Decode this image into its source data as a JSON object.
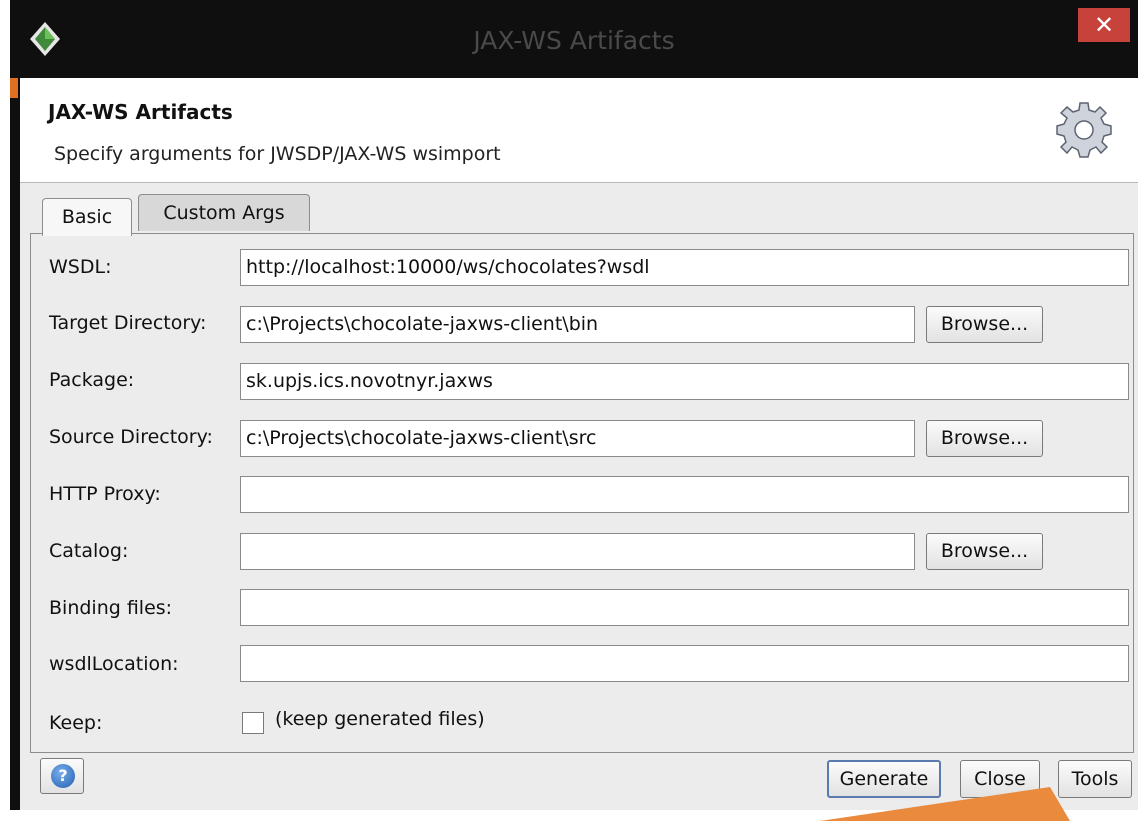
{
  "window": {
    "title": "JAX-WS Artifacts",
    "close_glyph": "✕",
    "app_icon": "diamond-app-icon"
  },
  "header": {
    "title": "JAX-WS Artifacts",
    "description": "Specify arguments for JWSDP/JAX-WS wsimport",
    "icon": "gear-icon"
  },
  "tabs": [
    {
      "label": "Basic",
      "selected": true
    },
    {
      "label": "Custom Args",
      "selected": false
    }
  ],
  "form": {
    "wsdl": {
      "label": "WSDL:",
      "value": "http://localhost:10000/ws/chocolates?wsdl"
    },
    "target_directory": {
      "label": "Target Directory:",
      "value": "c:\\Projects\\chocolate-jaxws-client\\bin",
      "browse_label": "Browse..."
    },
    "package": {
      "label": "Package:",
      "value": "sk.upjs.ics.novotnyr.jaxws"
    },
    "source_directory": {
      "label": "Source Directory:",
      "value": "c:\\Projects\\chocolate-jaxws-client\\src",
      "browse_label": "Browse..."
    },
    "http_proxy": {
      "label": "HTTP Proxy:",
      "value": ""
    },
    "catalog": {
      "label": "Catalog:",
      "value": "",
      "browse_label": "Browse..."
    },
    "binding_files": {
      "label": "Binding files:",
      "value": ""
    },
    "wsdl_location": {
      "label": "wsdlLocation:",
      "value": ""
    },
    "keep": {
      "label": "Keep:",
      "checkbox_label": "(keep generated files)",
      "checked": false
    }
  },
  "footer": {
    "help_glyph": "?",
    "generate_label": "Generate",
    "close_label": "Close",
    "tools_label": "Tools"
  },
  "colors": {
    "titlebar": "#0f0f0f",
    "close_button": "#c8423c",
    "dialog_background": "#ececec",
    "callout": "#e98a3c"
  }
}
